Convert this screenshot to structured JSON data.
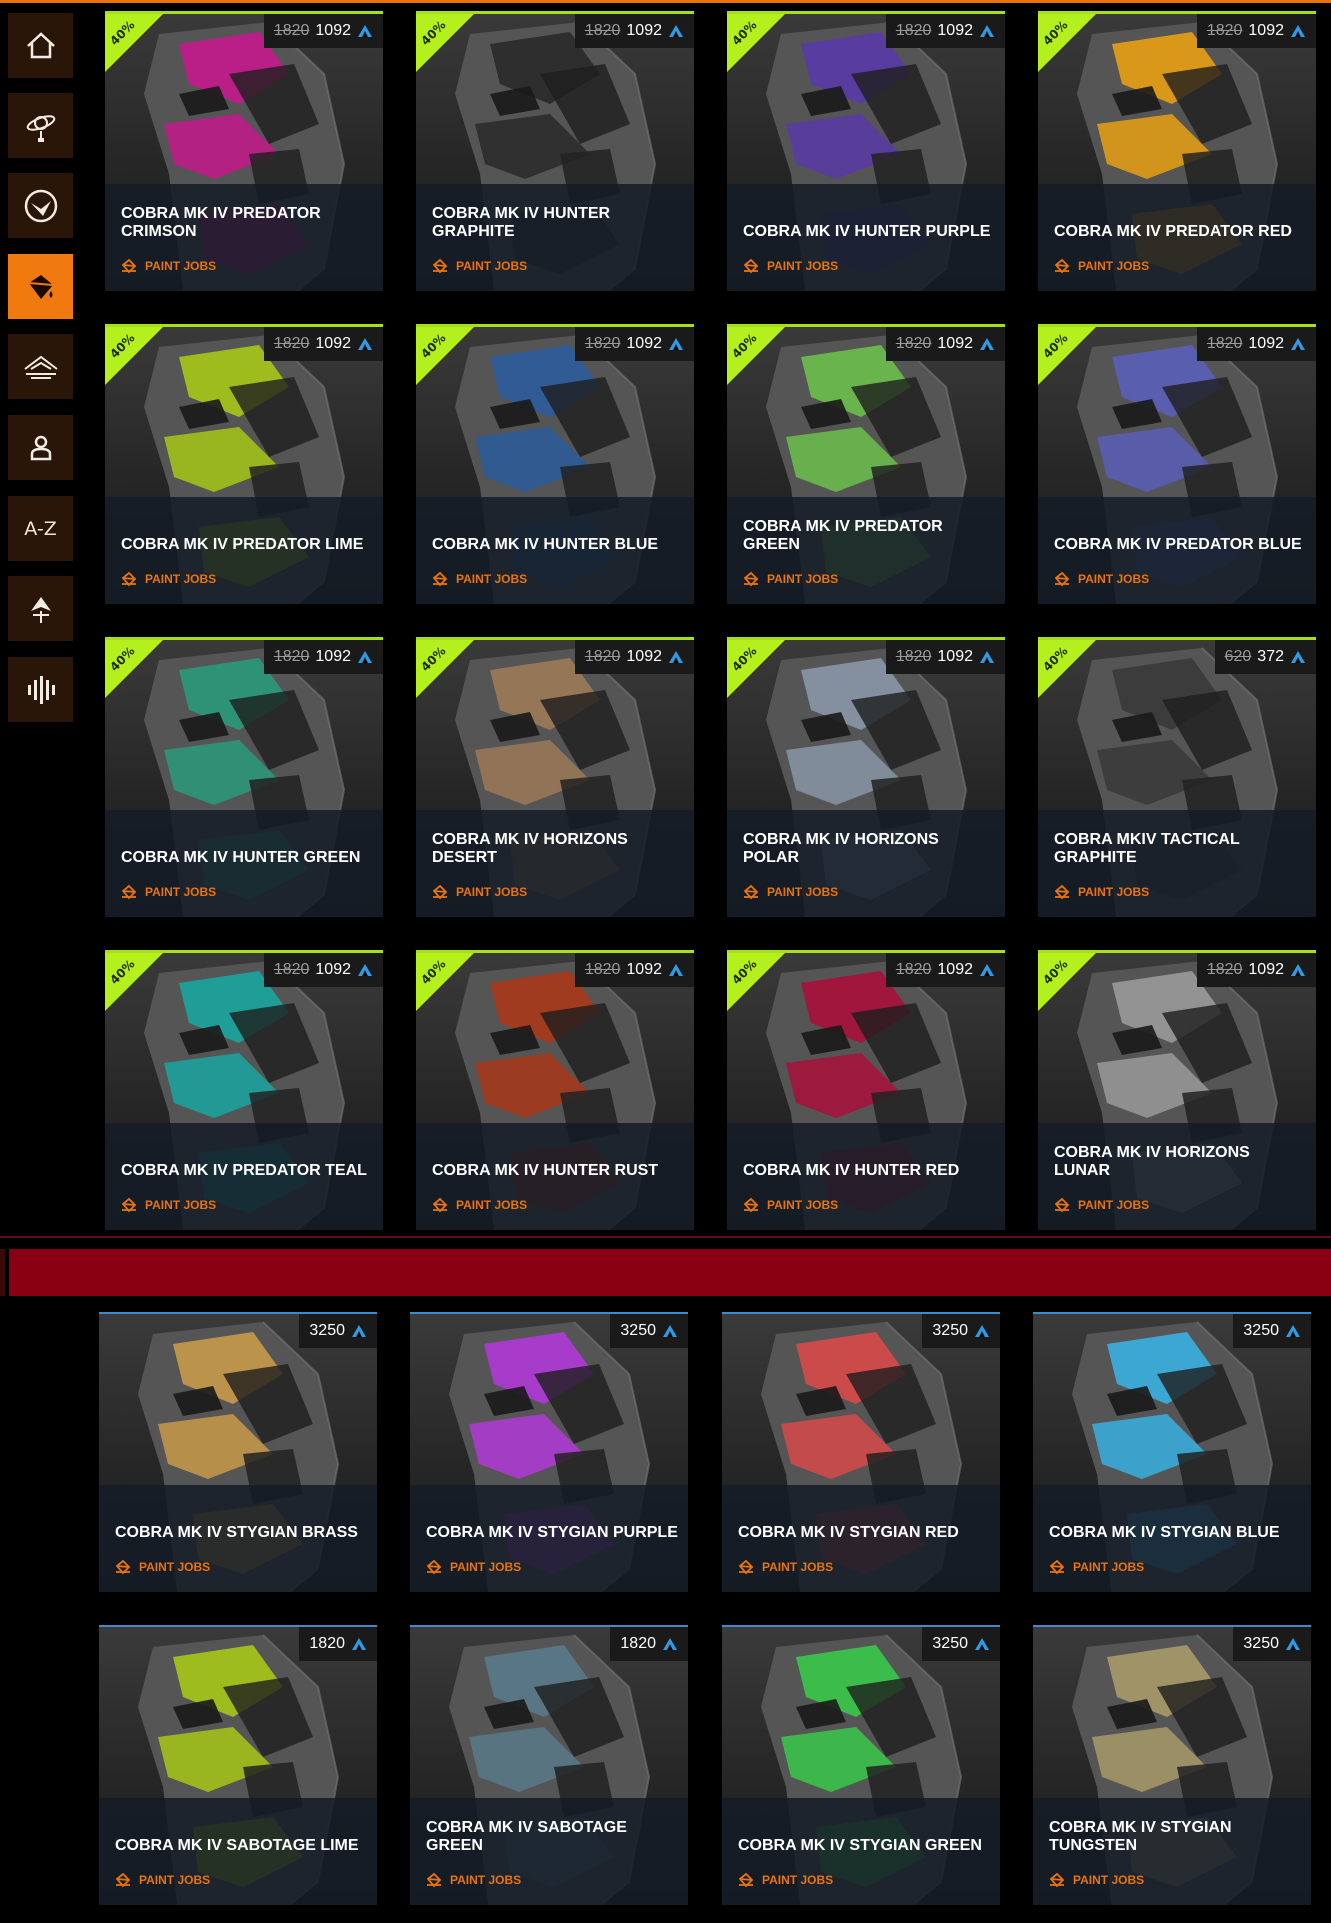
{
  "sidebar": {
    "items": [
      {
        "name": "home",
        "icon": "home-icon",
        "active": false
      },
      {
        "name": "ships",
        "icon": "planet-icon",
        "active": false
      },
      {
        "name": "emblem",
        "icon": "emblem-icon",
        "active": false
      },
      {
        "name": "paint",
        "icon": "paint-bucket-icon",
        "active": true
      },
      {
        "name": "hangar",
        "icon": "hangar-icon",
        "active": false
      },
      {
        "name": "commander",
        "icon": "user-icon",
        "active": false
      },
      {
        "name": "az",
        "label": "A-Z",
        "active": false
      },
      {
        "name": "ship-kit",
        "icon": "ship-kit-icon",
        "active": false
      },
      {
        "name": "audio",
        "icon": "audio-bars-icon",
        "active": false
      }
    ]
  },
  "colors": {
    "accent": "#f07a10",
    "sale_badge": "#b3f01d",
    "banner": "#8a0012",
    "arx": "#2f9be6"
  },
  "category_label": "PAINT JOBS",
  "sale_cards": [
    {
      "title": "COBRA MK IV PREDATOR CRIMSON",
      "old_price": "1820",
      "price": "1092",
      "badge": "40%",
      "color": "#c41a8c"
    },
    {
      "title": "COBRA MK IV HUNTER GRAPHITE",
      "old_price": "1820",
      "price": "1092",
      "badge": "40%",
      "color": "#2a2a2a"
    },
    {
      "title": "COBRA MK IV HUNTER PURPLE",
      "old_price": "1820",
      "price": "1092",
      "badge": "40%",
      "color": "#5a3aa8"
    },
    {
      "title": "COBRA MK IV PREDATOR RED",
      "old_price": "1820",
      "price": "1092",
      "badge": "40%",
      "color": "#e8a014"
    },
    {
      "title": "COBRA MK IV PREDATOR LIME",
      "old_price": "1820",
      "price": "1092",
      "badge": "40%",
      "color": "#a6c818"
    },
    {
      "title": "COBRA MK IV HUNTER BLUE",
      "old_price": "1820",
      "price": "1092",
      "badge": "40%",
      "color": "#2c5c9c"
    },
    {
      "title": "COBRA MK IV PREDATOR GREEN",
      "old_price": "1820",
      "price": "1092",
      "badge": "40%",
      "color": "#6cbf4c"
    },
    {
      "title": "COBRA MK IV PREDATOR BLUE",
      "old_price": "1820",
      "price": "1092",
      "badge": "40%",
      "color": "#5a5fb8"
    },
    {
      "title": "COBRA MK IV HUNTER GREEN",
      "old_price": "1820",
      "price": "1092",
      "badge": "40%",
      "color": "#2a9a7a"
    },
    {
      "title": "COBRA MK IV HORIZONS DESERT",
      "old_price": "1820",
      "price": "1092",
      "badge": "40%",
      "color": "#9c7a58"
    },
    {
      "title": "COBRA MK IV HORIZONS POLAR",
      "old_price": "1820",
      "price": "1092",
      "badge": "40%",
      "color": "#8a96a8"
    },
    {
      "title": "COBRA MKIV TACTICAL GRAPHITE",
      "old_price": "620",
      "price": "372",
      "badge": "40%",
      "color": "#3a3a3a"
    },
    {
      "title": "COBRA MK IV PREDATOR TEAL",
      "old_price": "1820",
      "price": "1092",
      "badge": "40%",
      "color": "#1aa6a0"
    },
    {
      "title": "COBRA MK IV HUNTER RUST",
      "old_price": "1820",
      "price": "1092",
      "badge": "40%",
      "color": "#a8381a"
    },
    {
      "title": "COBRA MK IV HUNTER RED",
      "old_price": "1820",
      "price": "1092",
      "badge": "40%",
      "color": "#a8103a"
    },
    {
      "title": "COBRA MK IV HORIZONS LUNAR",
      "old_price": "1820",
      "price": "1092",
      "badge": "40%",
      "color": "#9a9a9a"
    }
  ],
  "new_cards": [
    {
      "title": "COBRA MK IV STYGIAN BRASS",
      "price": "3250",
      "color": "#c89a4a"
    },
    {
      "title": "COBRA MK IV STYGIAN PURPLE",
      "price": "3250",
      "color": "#b03ad8"
    },
    {
      "title": "COBRA MK IV STYGIAN RED",
      "price": "3250",
      "color": "#d84a4a"
    },
    {
      "title": "COBRA MK IV STYGIAN BLUE",
      "price": "3250",
      "color": "#3ab0e0"
    },
    {
      "title": "COBRA MK IV SABOTAGE LIME",
      "price": "1820",
      "color": "#a6c818"
    },
    {
      "title": "COBRA MK IV SABOTAGE GREEN",
      "price": "1820",
      "color": "#5a7a8a"
    },
    {
      "title": "COBRA MK IV STYGIAN GREEN",
      "price": "3250",
      "color": "#3ac84a"
    },
    {
      "title": "COBRA MK IV STYGIAN TUNGSTEN",
      "price": "3250",
      "color": "#a89a6a"
    }
  ]
}
